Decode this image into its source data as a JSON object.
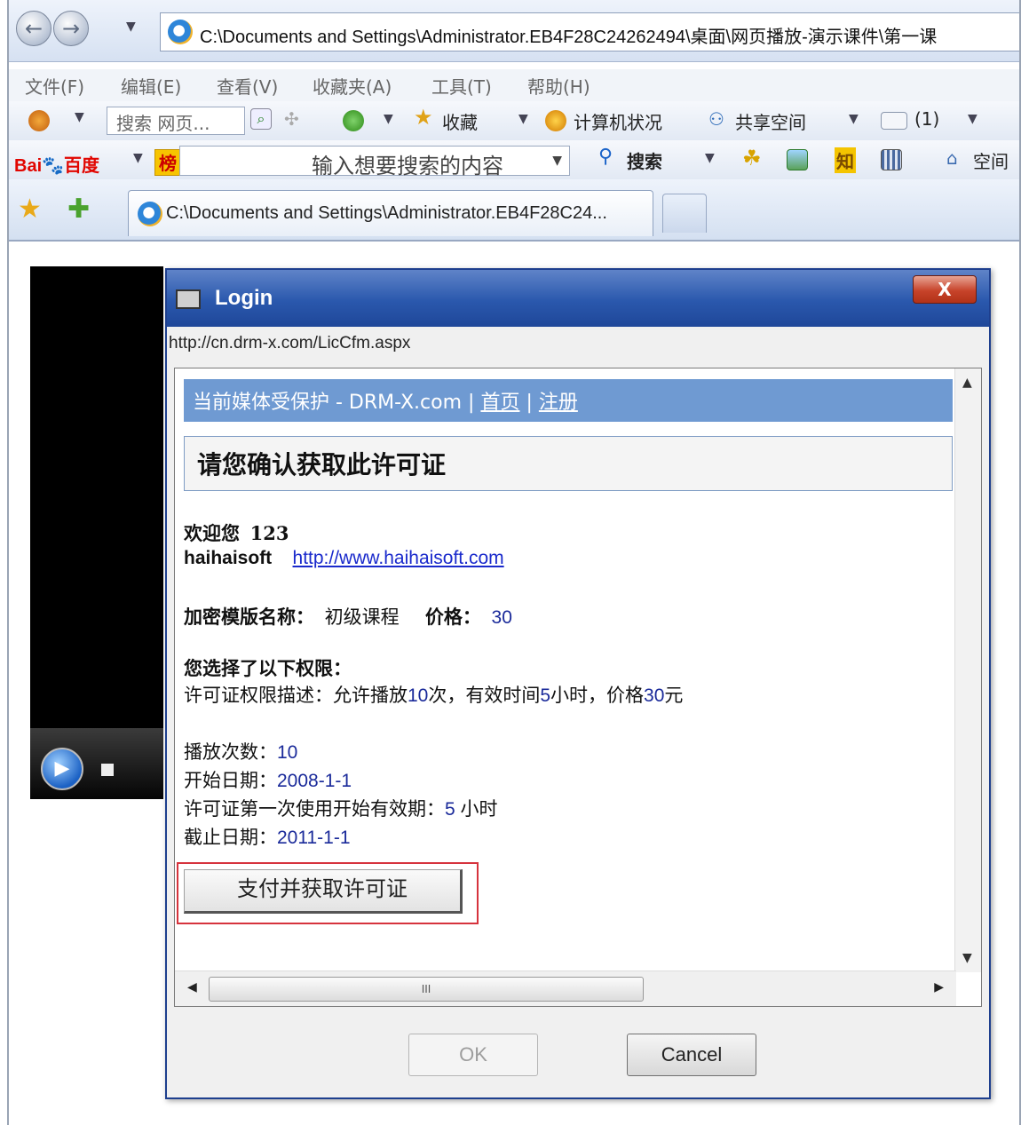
{
  "browser": {
    "address": "C:\\Documents and Settings\\Administrator.EB4F28C24262494\\桌面\\网页播放-演示课件\\第一课",
    "menu": [
      "文件(F)",
      "编辑(E)",
      "查看(V)",
      "收藏夹(A)",
      "工具(T)",
      "帮助(H)"
    ],
    "toolbar1": {
      "search_placeholder": "搜索 网页...",
      "favorites": "收藏",
      "pc_status": "计算机状况",
      "shared_space": "共享空间",
      "mail_count": "(1)"
    },
    "toolbar2": {
      "baidu_logo_left": "Bai",
      "baidu_logo_right": "百度",
      "bang_label": "榜",
      "search_placeholder": "输入想要搜索的内容",
      "search_button": "搜索",
      "zhi": "知",
      "space": "空间"
    },
    "tab_title": "C:\\Documents and Settings\\Administrator.EB4F28C24..."
  },
  "dialog": {
    "title": "Login",
    "close_label": "X",
    "url": "http://cn.drm-x.com/LicCfm.aspx",
    "page": {
      "nav_text": "当前媒体受保护 - DRM-X.com | ",
      "nav_home": "首页",
      "nav_sep": " | ",
      "nav_register": "注册",
      "heading": "请您确认获取此许可证",
      "welcome_label": "欢迎您",
      "welcome_user": "123",
      "company": "haihaisoft",
      "company_url": "http://www.haihaisoft.com",
      "template_label": "加密模版名称：",
      "template_name": "初级课程",
      "price_label": "价格：",
      "price_value": "30",
      "rights_heading": "您选择了以下权限：",
      "rights_desc_label": "许可证权限描述：",
      "rights_desc_a": "允许播放",
      "rights_desc_b": "10",
      "rights_desc_c": "次，有效时间",
      "rights_desc_d": "5",
      "rights_desc_e": "小时，价格",
      "rights_desc_f": "30",
      "rights_desc_g": "元",
      "play_count_label": "播放次数：",
      "play_count": "10",
      "start_date_label": "开始日期：",
      "start_date": "2008-1-1",
      "first_use_label": "许可证第一次使用开始有效期：",
      "first_use_value": "5",
      "first_use_unit": "小时",
      "end_date_label": "截止日期：",
      "end_date": "2011-1-1",
      "pay_button": "支付并获取许可证"
    },
    "hscroll_label": "III",
    "ok_label": "OK",
    "cancel_label": "Cancel"
  }
}
